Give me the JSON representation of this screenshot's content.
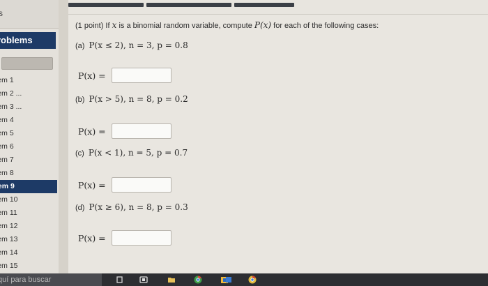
{
  "sidebar": {
    "top_text": "s",
    "section_title": "roblems",
    "items": [
      {
        "label": "lem 1",
        "active": false
      },
      {
        "label": "lem 2 ...",
        "active": false
      },
      {
        "label": "lem 3 ...",
        "active": false
      },
      {
        "label": "lem 4",
        "active": false
      },
      {
        "label": "lem 5",
        "active": false
      },
      {
        "label": "lem 6",
        "active": false
      },
      {
        "label": "lem 7",
        "active": false
      },
      {
        "label": "lem 8",
        "active": false
      },
      {
        "label": "lem 9",
        "active": true
      },
      {
        "label": "lem 10",
        "active": false
      },
      {
        "label": "lem 11",
        "active": false
      },
      {
        "label": "lem 12",
        "active": false
      },
      {
        "label": "lem 13",
        "active": false
      },
      {
        "label": "lem 14",
        "active": false
      },
      {
        "label": "lem 15",
        "active": false
      }
    ]
  },
  "problem": {
    "statement_prefix": "(1 point) If",
    "statement_var": "x",
    "statement_mid": "is a binomial random variable, compute",
    "statement_func": "P(x)",
    "statement_suffix": "for each of the following cases:",
    "parts": [
      {
        "label": "(a)",
        "expr": "P(x ≤ 2), n = 3, p = 0.8",
        "answer_label": "P(x) =",
        "answer_value": ""
      },
      {
        "label": "(b)",
        "expr": "P(x > 5), n = 8, p = 0.2",
        "answer_label": "P(x) =",
        "answer_value": ""
      },
      {
        "label": "(c)",
        "expr": "P(x < 1), n = 5, p = 0.7",
        "answer_label": "P(x) =",
        "answer_value": ""
      },
      {
        "label": "(d)",
        "expr": "P(x ≥ 6), n = 8, p = 0.3",
        "answer_label": "P(x) =",
        "answer_value": ""
      }
    ]
  },
  "taskbar": {
    "search_placeholder": "quí para buscar",
    "icons": [
      "task-view-icon",
      "file-explorer-icon",
      "folder-icon",
      "chrome-icon",
      "store-icon",
      "photos-icon",
      "chrome-alt-icon"
    ]
  },
  "colors": {
    "accent": "#1d3a66",
    "taskbar": "#2d2e32"
  }
}
